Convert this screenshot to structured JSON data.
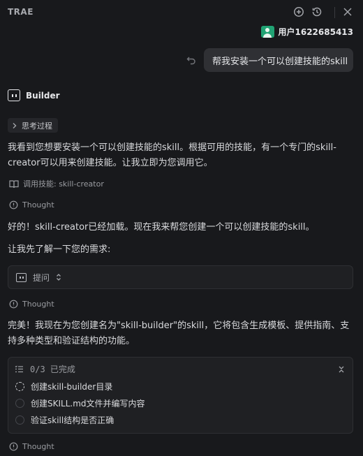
{
  "topbar": {
    "title": "TRAE"
  },
  "user": {
    "name": "用户1622685413"
  },
  "user_message": "帮我安装一个可以创建技能的skill",
  "bot": {
    "name": "Builder"
  },
  "thinking": {
    "label": "思考过程"
  },
  "messages": {
    "intro": "我看到您想要安装一个可以创建技能的skill。根据可用的技能，有一个专门的skill-creator可以用来创建技能。让我立即为您调用它。",
    "skill_call": "调用技能: skill-creator",
    "thought_label": "Thought",
    "loaded": "好的！skill-creator已经加载。现在我来帮您创建一个可以创建技能的skill。",
    "ask_first": "让我先了解一下您的需求:",
    "plan": "完美！我现在为您创建名为\"skill-builder\"的skill，它将包含生成模板、提供指南、支持多种类型和验证结构的功能。"
  },
  "ask_card": {
    "label": "提问"
  },
  "todo": {
    "progress": "0/3 已完成",
    "items": [
      {
        "label": "创建skill-builder目录",
        "status": "in-progress"
      },
      {
        "label": "创建SKILL.md文件并编写内容",
        "status": "pending"
      },
      {
        "label": "验证skill结构是否正确",
        "status": "pending"
      }
    ]
  },
  "colors": {
    "background": "#18191c",
    "accent_avatar": "#21a374",
    "card": "#1f2023"
  }
}
